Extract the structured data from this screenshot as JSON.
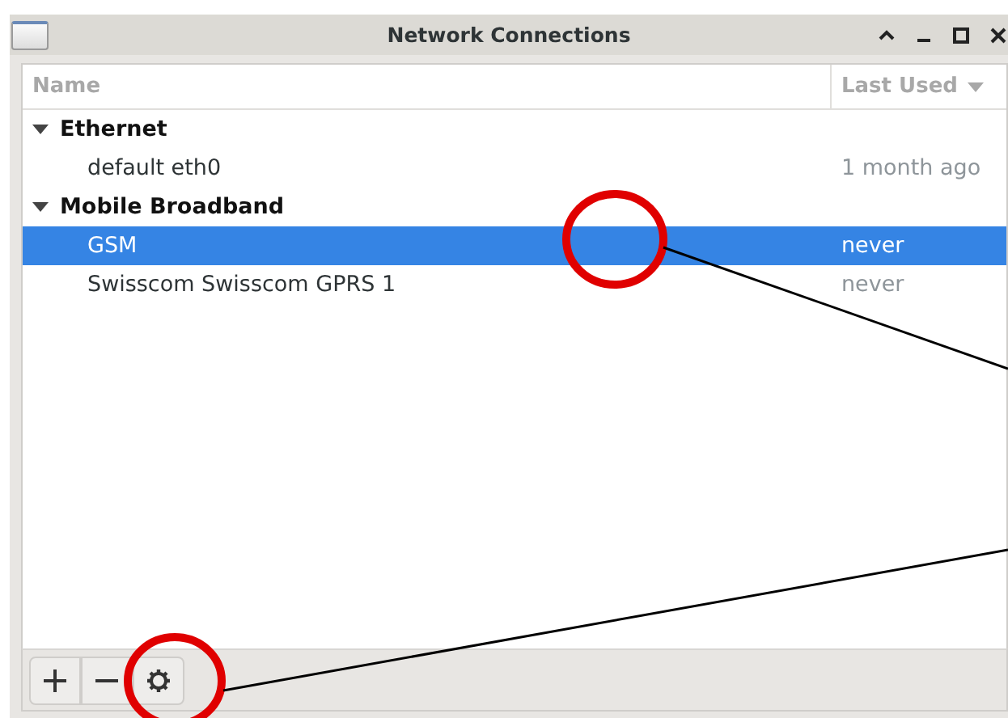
{
  "window": {
    "title": "Network Connections"
  },
  "columns": [
    {
      "label": "Name",
      "sorted": false
    },
    {
      "label": "Last Used",
      "sorted": true
    }
  ],
  "groups": [
    {
      "label": "Ethernet",
      "expanded": true,
      "children": [
        {
          "name": "default eth0",
          "last_used": "1 month ago",
          "selected": false
        }
      ]
    },
    {
      "label": "Mobile Broadband",
      "expanded": true,
      "children": [
        {
          "name": "GSM",
          "last_used": "never",
          "selected": true
        },
        {
          "name": "Swisscom Swisscom GPRS 1",
          "last_used": "never",
          "selected": false
        }
      ]
    }
  ],
  "toolbar": [
    {
      "kind": "add"
    },
    {
      "kind": "remove"
    },
    {
      "kind": "settings"
    }
  ]
}
